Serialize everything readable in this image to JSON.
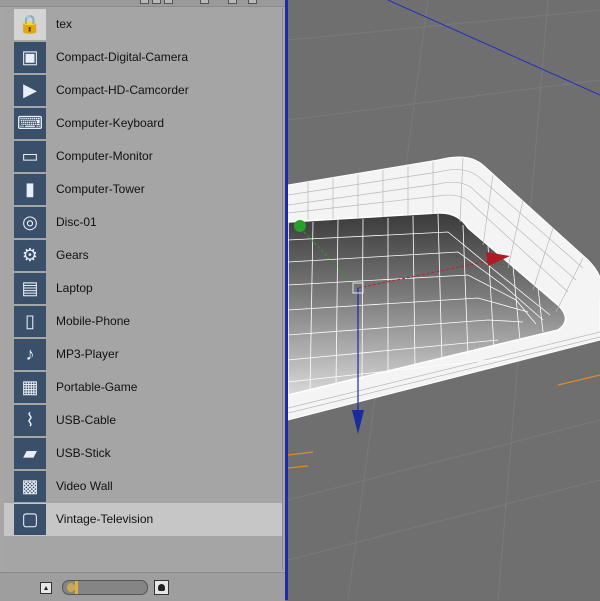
{
  "browser": {
    "items": [
      {
        "label": "tex",
        "icon": "folder-lock-icon",
        "selected": false
      },
      {
        "label": "Compact-Digital-Camera",
        "icon": "camera-icon",
        "selected": false
      },
      {
        "label": "Compact-HD-Camcorder",
        "icon": "camcorder-icon",
        "selected": false
      },
      {
        "label": "Computer-Keyboard",
        "icon": "keyboard-icon",
        "selected": false
      },
      {
        "label": "Computer-Monitor",
        "icon": "monitor-icon",
        "selected": false
      },
      {
        "label": "Computer-Tower",
        "icon": "tower-icon",
        "selected": false
      },
      {
        "label": "Disc-01",
        "icon": "disc-icon",
        "selected": false
      },
      {
        "label": "Gears",
        "icon": "gears-icon",
        "selected": false
      },
      {
        "label": "Laptop",
        "icon": "laptop-icon",
        "selected": false
      },
      {
        "label": "Mobile-Phone",
        "icon": "mobile-phone-icon",
        "selected": false
      },
      {
        "label": "MP3-Player",
        "icon": "mp3-player-icon",
        "selected": false
      },
      {
        "label": "Portable-Game",
        "icon": "portable-game-icon",
        "selected": false
      },
      {
        "label": "USB-Cable",
        "icon": "usb-cable-icon",
        "selected": false
      },
      {
        "label": "USB-Stick",
        "icon": "usb-stick-icon",
        "selected": false
      },
      {
        "label": "Video Wall",
        "icon": "video-wall-icon",
        "selected": false
      },
      {
        "label": "Vintage-Television",
        "icon": "television-icon",
        "selected": true
      }
    ],
    "thumbnail_size": 0.1
  },
  "colors": {
    "panel_bg": "#a6a6a6",
    "selected_row": "#c6c6c6",
    "divider": "#1e2ca8",
    "viewport_bg": "#6f6f6f",
    "axis_x": "#c0202a",
    "axis_y": "#2a9a2a",
    "axis_z": "#1a2aa0"
  }
}
